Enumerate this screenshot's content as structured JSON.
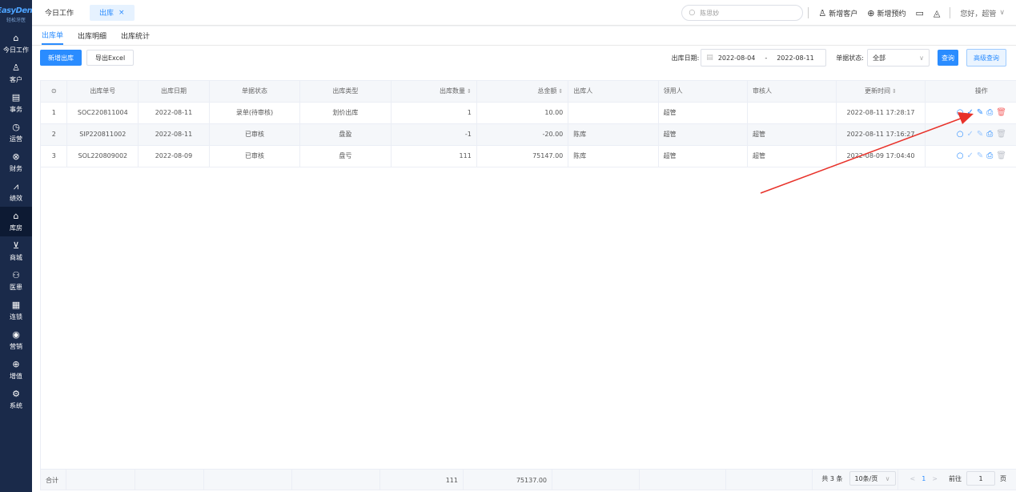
{
  "logo": {
    "brand": "EasyDent",
    "sub": "轻松牙医"
  },
  "sidebar": {
    "items": [
      {
        "label": "今日工作",
        "icon": "home-icon",
        "glyph": "⌂"
      },
      {
        "label": "客户",
        "icon": "user-icon",
        "glyph": "♙"
      },
      {
        "label": "事务",
        "icon": "task-icon",
        "glyph": "▤"
      },
      {
        "label": "运营",
        "icon": "clock-icon",
        "glyph": "◷"
      },
      {
        "label": "财务",
        "icon": "wallet-icon",
        "glyph": "⊗"
      },
      {
        "label": "绩效",
        "icon": "chart-icon",
        "glyph": "⩘"
      },
      {
        "label": "库房",
        "icon": "warehouse-icon",
        "glyph": "⌂"
      },
      {
        "label": "商城",
        "icon": "cart-icon",
        "glyph": "⊻"
      },
      {
        "label": "医患",
        "icon": "people-icon",
        "glyph": "⚇"
      },
      {
        "label": "连锁",
        "icon": "building-icon",
        "glyph": "▦"
      },
      {
        "label": "营销",
        "icon": "target-icon",
        "glyph": "◉"
      },
      {
        "label": "增值",
        "icon": "gift-icon",
        "glyph": "⊕"
      },
      {
        "label": "系统",
        "icon": "settings-icon",
        "glyph": "⚙"
      }
    ],
    "active_index": 6
  },
  "topbar": {
    "tabs": [
      {
        "label": "今日工作",
        "active": false
      },
      {
        "label": "出库",
        "active": true,
        "close": "×"
      }
    ],
    "search_placeholder": "陈思妙",
    "actions": {
      "new_customer": "新增客户",
      "new_booking": "新增预约"
    },
    "greeting": "您好，超管",
    "chevron": "∨"
  },
  "subtabs": [
    "出库单",
    "出库明细",
    "出库统计"
  ],
  "toolbar": {
    "new_button": "新增出库",
    "export_button": "导出Excel",
    "date_label": "出库日期:",
    "date_start": "2022-08-04",
    "date_sep": "-",
    "date_end": "2022-08-11",
    "status_label": "单据状态:",
    "status_value": "全部",
    "query_button": "查询",
    "advanced_button": "高级查询"
  },
  "table": {
    "headers": {
      "idx": "⊙",
      "no": "出库单号",
      "date": "出库日期",
      "status": "单据状态",
      "type": "出库类型",
      "qty": "出库数量",
      "amount": "总金额",
      "outby": "出库人",
      "receiver": "领用人",
      "auditor": "审核人",
      "updated": "更新时间",
      "ops": "操作"
    },
    "sort_glyph": "⇕",
    "rows": [
      {
        "idx": "1",
        "no": "SOC220811004",
        "date": "2022-08-11",
        "status": "录单(待审核)",
        "type": "划价出库",
        "qty": "1",
        "amount": "10.00",
        "outby": "",
        "receiver": "超管",
        "auditor": "",
        "updated": "2022-08-11 17:28:17"
      },
      {
        "idx": "2",
        "no": "SIP220811002",
        "date": "2022-08-11",
        "status": "已审核",
        "type": "盘盈",
        "qty": "-1",
        "amount": "-20.00",
        "outby": "陈库",
        "receiver": "超管",
        "auditor": "超管",
        "updated": "2022-08-11 17:16:27"
      },
      {
        "idx": "3",
        "no": "SOL220809002",
        "date": "2022-08-09",
        "status": "已审核",
        "type": "盘亏",
        "qty": "111",
        "amount": "75147.00",
        "outby": "陈库",
        "receiver": "超管",
        "auditor": "超管",
        "updated": "2022-08-09 17:04:40"
      }
    ],
    "summary": {
      "label": "合计",
      "qty": "111",
      "amount": "75137.00"
    }
  },
  "pager": {
    "total": "共 3 条",
    "page_size": "10条/页",
    "prev": "<",
    "current": "1",
    "next": ">",
    "goto_label": "前往",
    "goto_value": "1",
    "page_unit": "页"
  },
  "colors": {
    "accent": "#2a8cff",
    "sidebar": "#1a2a4a",
    "danger": "#f56c6c",
    "annotation": "#e8322a"
  }
}
